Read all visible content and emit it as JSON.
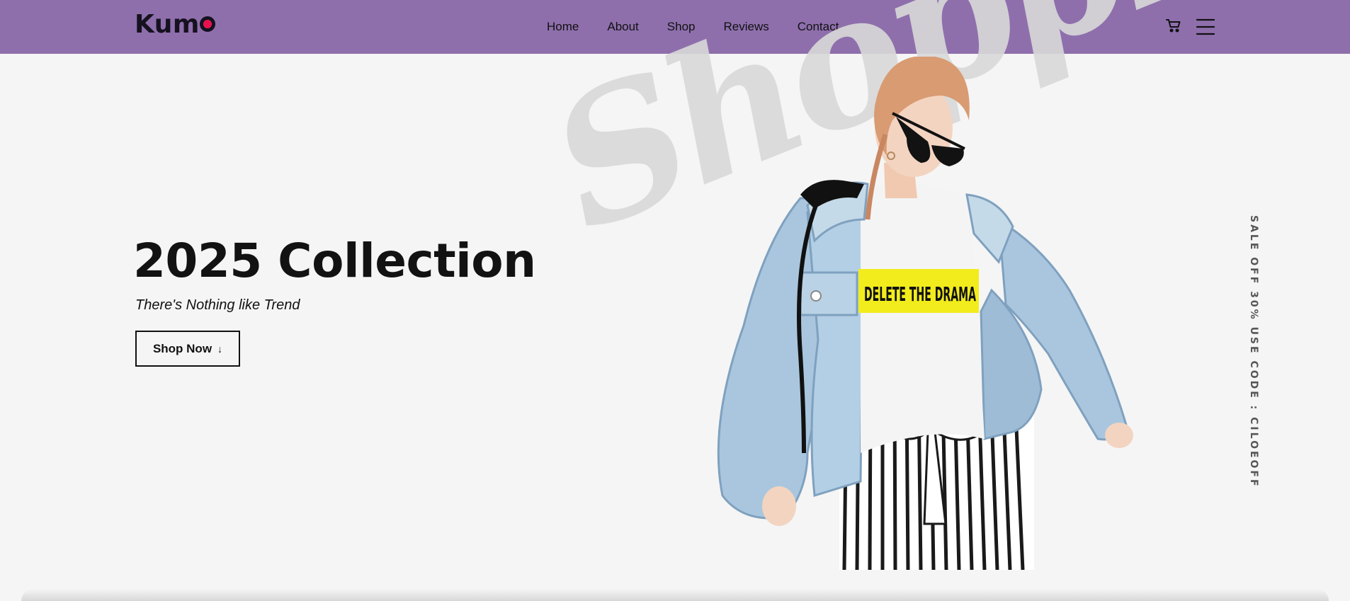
{
  "brand": {
    "logo_text": "Kum",
    "logo_last": "o",
    "accent_dot_color": "#e8114e",
    "header_color": "#8e6fac"
  },
  "nav": {
    "items": [
      "Home",
      "About",
      "Shop",
      "Reviews",
      "Contact"
    ]
  },
  "header_icons": {
    "cart": "cart-icon",
    "menu": "hamburger-menu-icon"
  },
  "hero": {
    "title": "2025 Collection",
    "subtitle": "There's Nothing like Trend",
    "cta_label": "Shop Now",
    "cta_icon": "arrow-down-icon",
    "watermark": "Shopping",
    "t_shirt_print": "DELETE THE DRAMA"
  },
  "promo": {
    "text": "SALE OFF 30% USE CODE : CILOEOFF"
  }
}
